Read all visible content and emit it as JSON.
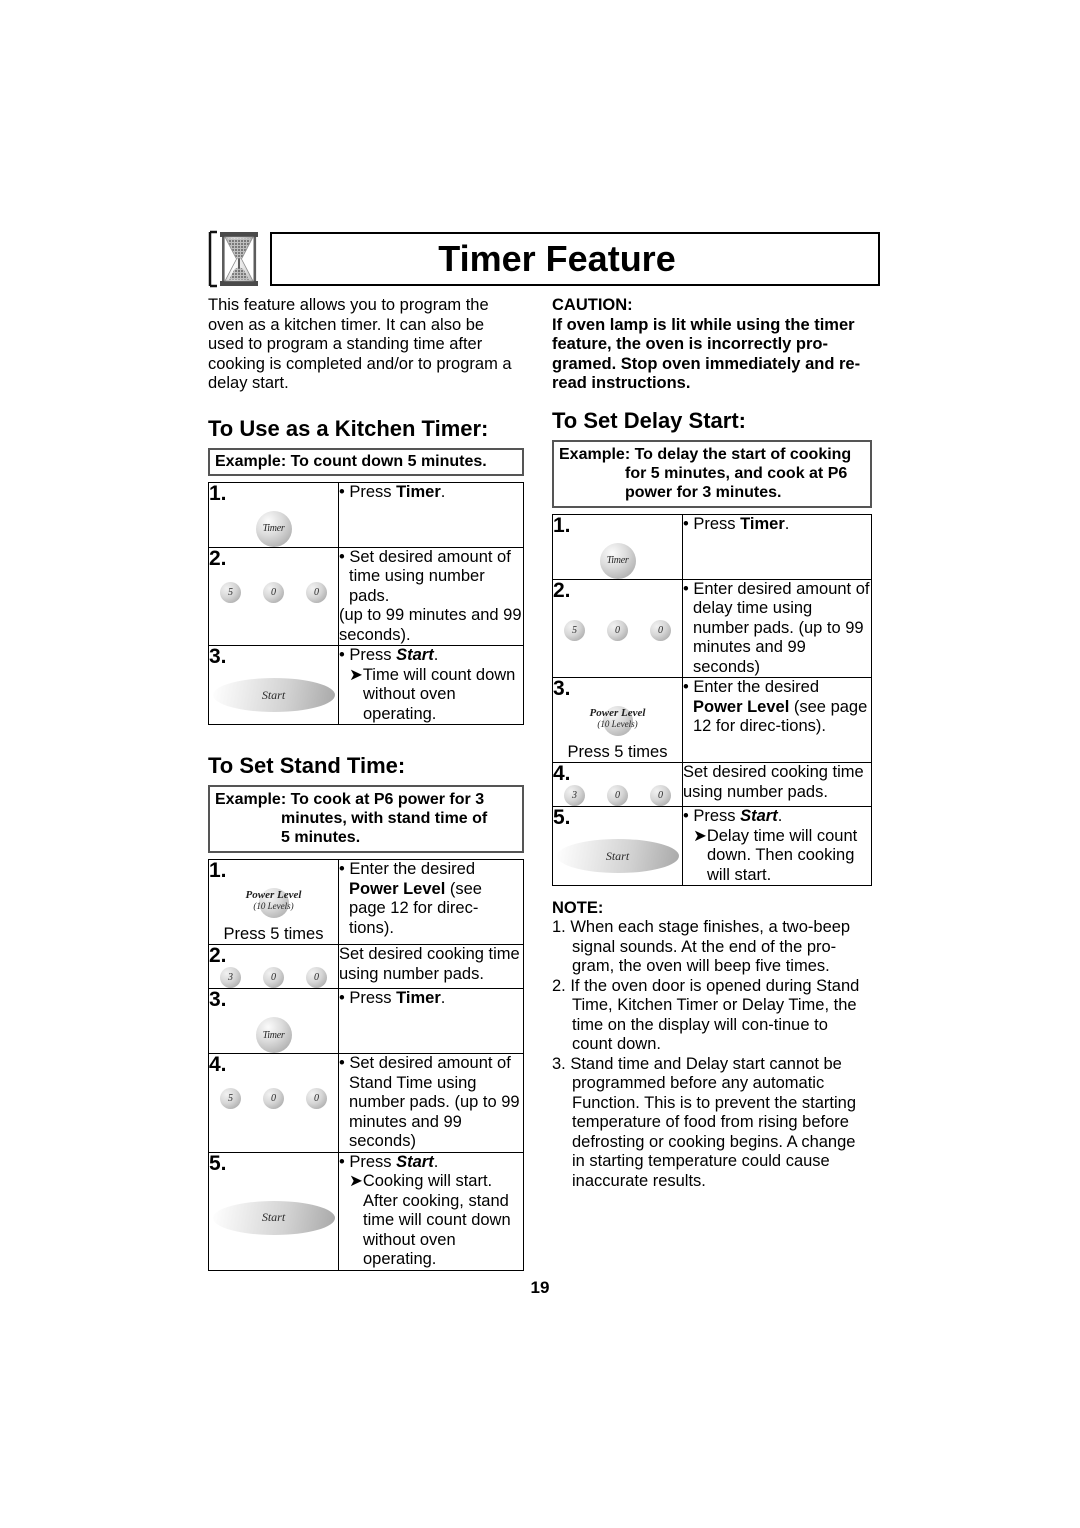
{
  "page": {
    "title": "Timer Feature",
    "page_number": "19",
    "hourglass_icon": "hourglass-icon"
  },
  "intro": {
    "text": "This feature allows you to program the oven as a kitchen timer. It can also be used to program a standing time after cooking is completed and/or to program a delay start."
  },
  "caution": {
    "heading": "CAUTION:",
    "text": "If oven lamp is lit while using the timer feature, the oven is incorrectly pro-gramed. Stop oven immediately and re-read instructions."
  },
  "kitchen_timer": {
    "heading": "To Use  as a Kitchen Timer:",
    "example_label": "Example: To count down 5 minutes.",
    "steps": [
      {
        "num": "1.",
        "control": "timer-button",
        "control_label": "Timer",
        "lines": [
          {
            "style": "bullet",
            "pre": "Press ",
            "bold": "Timer",
            "post": "."
          }
        ]
      },
      {
        "num": "2.",
        "control": "number-pads",
        "pads": [
          "5",
          "0",
          "0"
        ],
        "lines": [
          {
            "style": "bullet",
            "pre": "Set desired amount of time using number pads.",
            "bold": "",
            "post": ""
          },
          {
            "style": "plain",
            "pre": "(up to 99 minutes and 99 seconds).",
            "bold": "",
            "post": ""
          }
        ]
      },
      {
        "num": "3.",
        "control": "start-button",
        "control_label": "Start",
        "lines": [
          {
            "style": "bullet",
            "pre": "Press ",
            "bolditalic": "Start",
            "post": "."
          },
          {
            "style": "arrow",
            "pre": "Time will count down without oven operating.",
            "bold": "",
            "post": ""
          }
        ]
      }
    ]
  },
  "stand_time": {
    "heading": "To Set Stand Time:",
    "example_label": "Example: To cook at P6 power for 3",
    "example_line2": "minutes, with stand time of",
    "example_line3": "5 minutes.",
    "steps": [
      {
        "num": "1.",
        "control": "power-level-button",
        "control_label_1": "Power Level",
        "control_label_2": "(10 Levels)",
        "control_note": "Press 5 times",
        "lines": [
          {
            "style": "bullet",
            "pre": "Enter the desired ",
            "bold": "Power Level",
            "post": " (see page 12 for direc-tions)."
          }
        ]
      },
      {
        "num": "2.",
        "control": "number-pads",
        "pads": [
          "3",
          "0",
          "0"
        ],
        "lines": [
          {
            "style": "plain",
            "pre": "Set desired cooking time using number pads.",
            "bold": "",
            "post": ""
          }
        ]
      },
      {
        "num": "3.",
        "control": "timer-button",
        "control_label": "Timer",
        "lines": [
          {
            "style": "bullet",
            "pre": "Press ",
            "bold": "Timer",
            "post": "."
          }
        ]
      },
      {
        "num": "4.",
        "control": "number-pads",
        "pads": [
          "5",
          "0",
          "0"
        ],
        "lines": [
          {
            "style": "bullet",
            "pre": "Set desired amount of Stand Time using number pads. (up to 99 minutes and 99 seconds)",
            "bold": "",
            "post": ""
          }
        ]
      },
      {
        "num": "5.",
        "control": "start-button",
        "control_label": "Start",
        "lines": [
          {
            "style": "bullet",
            "pre": "Press ",
            "bolditalic": "Start",
            "post": "."
          },
          {
            "style": "arrow",
            "pre": "Cooking will start. After cooking, stand time will count down without oven operating.",
            "bold": "",
            "post": ""
          }
        ]
      }
    ]
  },
  "delay_start": {
    "heading": "To Set Delay Start:",
    "example_label": "Example: To delay the start of cooking",
    "example_line2": "for 5 minutes, and cook at P6",
    "example_line3": "power for 3 minutes.",
    "steps": [
      {
        "num": "1.",
        "control": "timer-button",
        "control_label": "Timer",
        "lines": [
          {
            "style": "bullet",
            "pre": "Press ",
            "bold": "Timer",
            "post": "."
          }
        ]
      },
      {
        "num": "2.",
        "control": "number-pads",
        "pads": [
          "5",
          "0",
          "0"
        ],
        "lines": [
          {
            "style": "bullet",
            "pre": "Enter desired amount of delay time using number pads. (up to 99 minutes and 99 seconds)",
            "bold": "",
            "post": ""
          }
        ]
      },
      {
        "num": "3.",
        "control": "power-level-button",
        "control_label_1": "Power Level",
        "control_label_2": "(10 Levels)",
        "control_note": "Press 5 times",
        "lines": [
          {
            "style": "bullet",
            "pre": "Enter the desired ",
            "bold": "Power Level",
            "post": " (see page 12 for direc-tions)."
          }
        ]
      },
      {
        "num": "4.",
        "control": "number-pads",
        "pads": [
          "3",
          "0",
          "0"
        ],
        "lines": [
          {
            "style": "plain",
            "pre": "Set desired cooking time using number pads.",
            "bold": "",
            "post": ""
          }
        ]
      },
      {
        "num": "5.",
        "control": "start-button",
        "control_label": "Start",
        "lines": [
          {
            "style": "bullet",
            "pre": "Press ",
            "bolditalic": "Start",
            "post": "."
          },
          {
            "style": "arrow",
            "pre": "Delay time will count down. Then cooking will start.",
            "bold": "",
            "post": ""
          }
        ]
      }
    ]
  },
  "note": {
    "heading": "NOTE:",
    "items": [
      "1. When each stage finishes, a two-beep signal sounds. At the end of the pro-gram, the oven will beep five times.",
      "2. If the oven door is opened during Stand Time, Kitchen Timer or Delay Time, the time on the display will con-tinue to count down.",
      "3. Stand time and Delay start cannot be programmed before any automatic Function. This is to prevent the starting temperature of food from rising before defrosting or cooking begins. A change in starting temperature could cause inaccurate results."
    ]
  }
}
